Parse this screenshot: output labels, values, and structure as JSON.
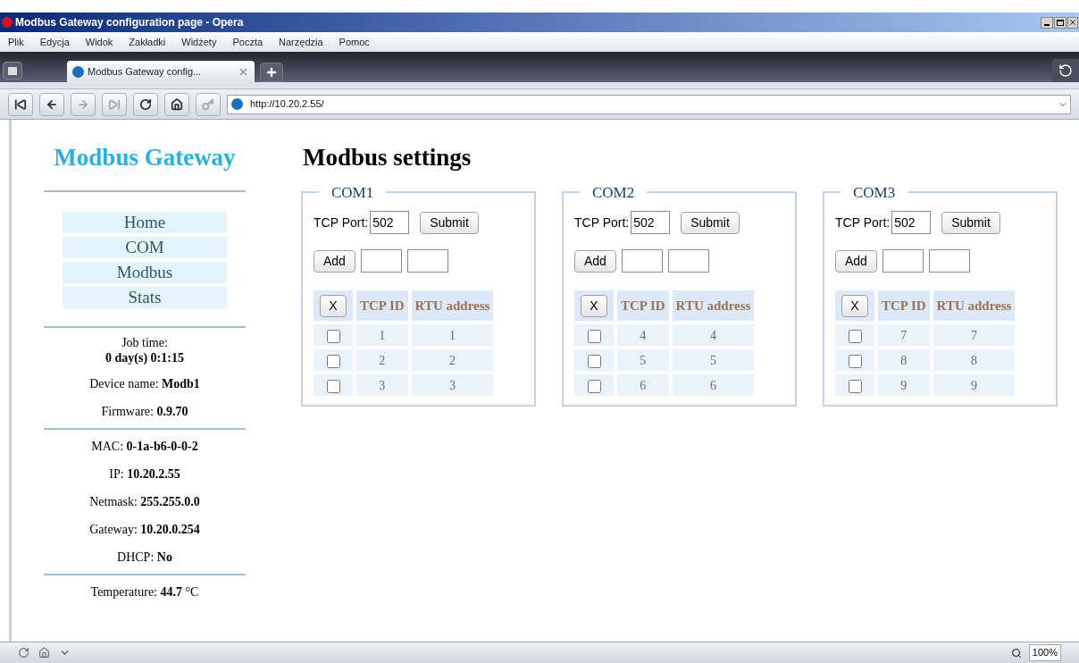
{
  "window": {
    "title": "Modbus Gateway configuration page - Opera"
  },
  "menu": [
    "Plik",
    "Edycja",
    "Widok",
    "Zakładki",
    "Widżety",
    "Poczta",
    "Narzędzia",
    "Pomoc"
  ],
  "tabs": [
    {
      "label": "Modbus Gateway config...",
      "selected": true
    }
  ],
  "address": {
    "value": "http://10.20.2.55/"
  },
  "sidebar": {
    "title": "Modbus Gateway",
    "nav": [
      {
        "label": "Home"
      },
      {
        "label": "COM"
      },
      {
        "label": "Modbus"
      },
      {
        "label": "Stats"
      }
    ],
    "groups": [
      [
        {
          "label": "Job time:",
          "value": "0 day(s) 0:1:15",
          "stacked": true
        },
        {
          "label": "Device name:",
          "value": "Modb1",
          "stacked": false
        },
        {
          "label": "Firmware:",
          "value": "0.9.70",
          "stacked": false
        }
      ],
      [
        {
          "label": "MAC:",
          "value": "0-1a-b6-0-0-2",
          "stacked": false
        },
        {
          "label": "IP:",
          "value": "10.20.2.55",
          "stacked": false
        },
        {
          "label": "Netmask:",
          "value": "255.255.0.0",
          "stacked": false
        },
        {
          "label": "Gateway:",
          "value": "10.20.0.254",
          "stacked": false
        },
        {
          "label": "DHCP:",
          "value": "No",
          "stacked": false
        }
      ],
      [
        {
          "label": "Temperature:",
          "value": "44.7",
          "unit": "°C",
          "stacked": false
        }
      ]
    ]
  },
  "main": {
    "title": "Modbus settings",
    "ports": [
      {
        "legend": "COM1",
        "port_label": "TCP Port:",
        "port_value": "502",
        "submit": "Submit",
        "add": "Add",
        "columns": [
          "X",
          "TCP ID",
          "RTU address"
        ],
        "rows": [
          {
            "checked": false,
            "tcp_id": "1",
            "rtu": "1"
          },
          {
            "checked": false,
            "tcp_id": "2",
            "rtu": "2"
          },
          {
            "checked": false,
            "tcp_id": "3",
            "rtu": "3"
          }
        ]
      },
      {
        "legend": "COM2",
        "port_label": "TCP Port:",
        "port_value": "502",
        "submit": "Submit",
        "add": "Add",
        "columns": [
          "X",
          "TCP ID",
          "RTU address"
        ],
        "rows": [
          {
            "checked": false,
            "tcp_id": "4",
            "rtu": "4"
          },
          {
            "checked": false,
            "tcp_id": "5",
            "rtu": "5"
          },
          {
            "checked": false,
            "tcp_id": "6",
            "rtu": "6"
          }
        ]
      },
      {
        "legend": "COM3",
        "port_label": "TCP Port:",
        "port_value": "502",
        "submit": "Submit",
        "add": "Add",
        "columns": [
          "X",
          "TCP ID",
          "RTU address"
        ],
        "rows": [
          {
            "checked": false,
            "tcp_id": "7",
            "rtu": "7"
          },
          {
            "checked": false,
            "tcp_id": "8",
            "rtu": "8"
          },
          {
            "checked": false,
            "tcp_id": "9",
            "rtu": "9"
          }
        ]
      }
    ]
  },
  "status_bar": {
    "zoom": "100%"
  }
}
